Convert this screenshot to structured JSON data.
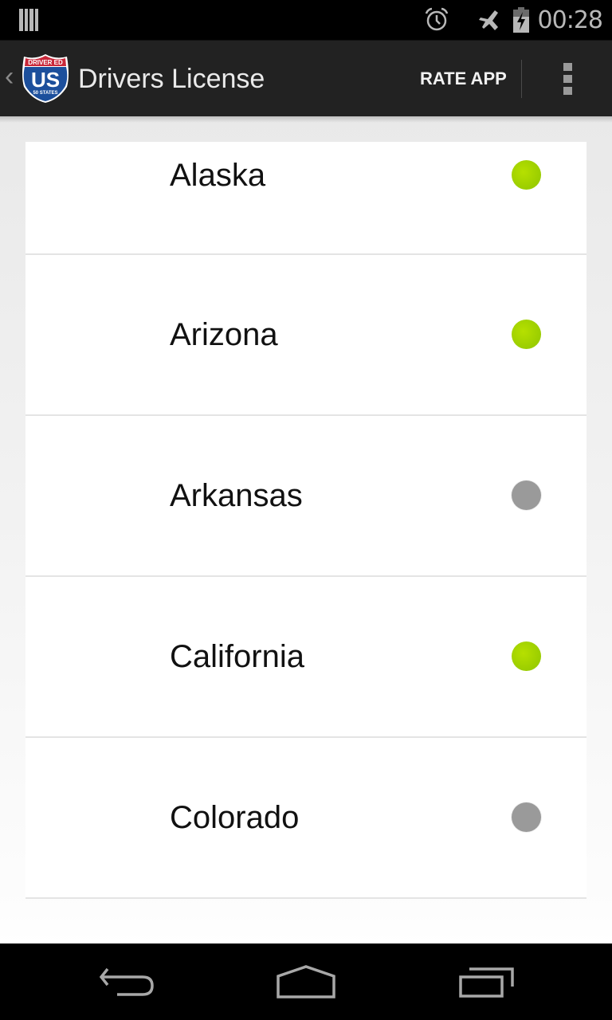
{
  "status_bar": {
    "time": "00:28",
    "icons": [
      "notification-bars-icon",
      "alarm-icon",
      "airplane-mode-icon",
      "battery-charging-icon"
    ]
  },
  "action_bar": {
    "title": "Drivers License",
    "logo": {
      "top_text": "DRIVER ED",
      "main_text": "US",
      "bottom_text": "50 STATES"
    },
    "rate_app_label": "RATE APP",
    "overflow_icon": "overflow-menu-icon",
    "up_icon": "up-caret-icon"
  },
  "colors": {
    "action_bar_bg": "#222222",
    "complete": "#9acd00",
    "incomplete": "#9a9a9a"
  },
  "states": [
    {
      "name": "Alaska",
      "status": "complete"
    },
    {
      "name": "Arizona",
      "status": "complete"
    },
    {
      "name": "Arkansas",
      "status": "incomplete"
    },
    {
      "name": "California",
      "status": "complete"
    },
    {
      "name": "Colorado",
      "status": "incomplete"
    }
  ],
  "nav_bar": {
    "buttons": [
      "back",
      "home",
      "recents"
    ]
  }
}
